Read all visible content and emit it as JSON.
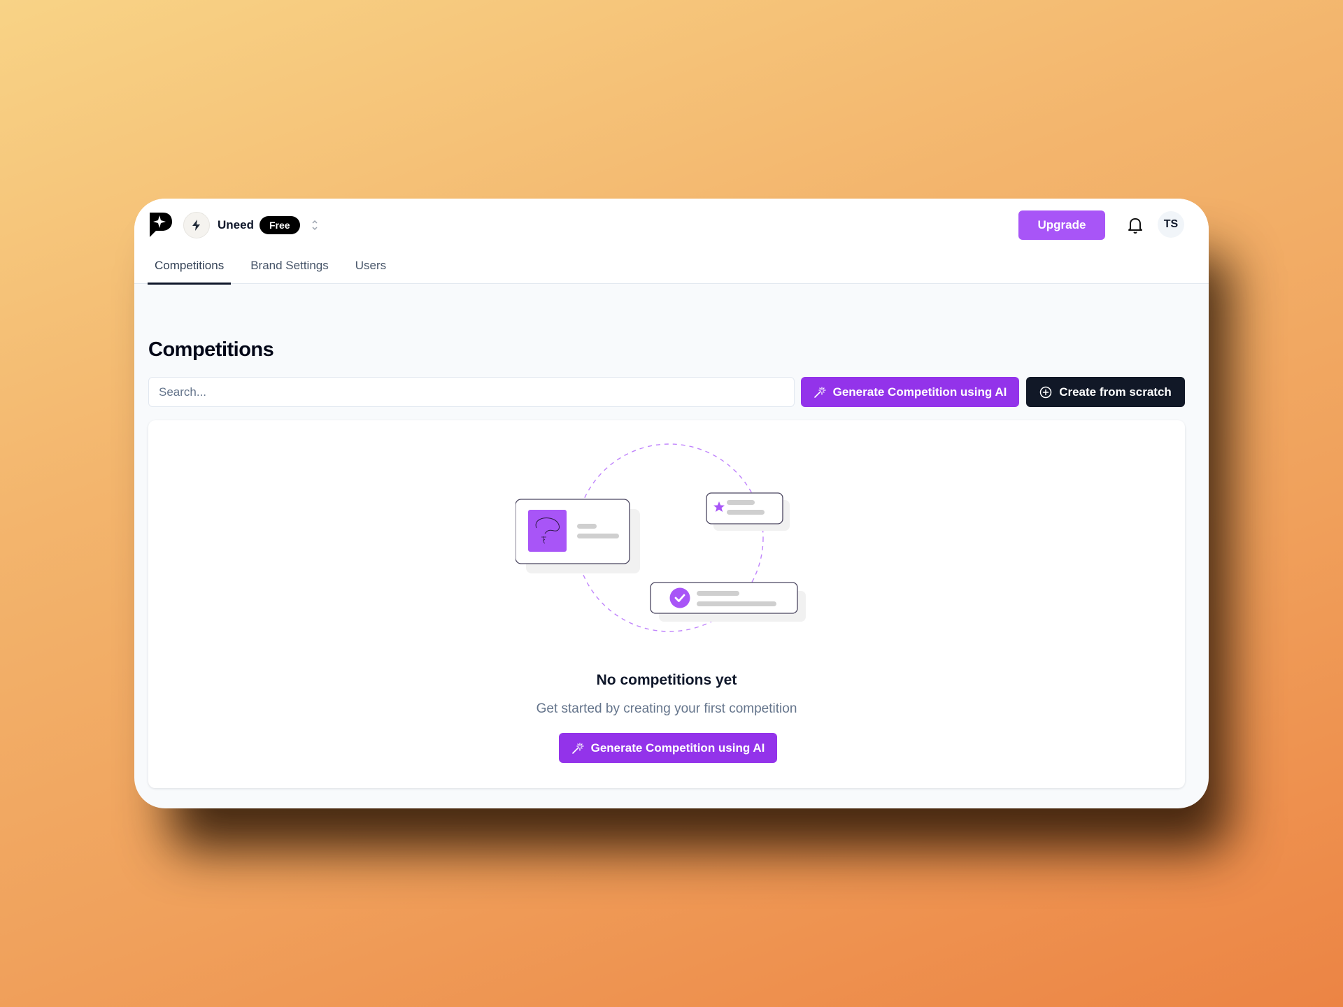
{
  "header": {
    "workspace_name": "Uneed",
    "plan_badge": "Free",
    "upgrade_label": "Upgrade",
    "avatar_initials": "TS",
    "icons": {
      "logo": "brand-logo-icon",
      "workspace": "lightning-icon",
      "switcher": "chevron-up-down-icon",
      "notifications": "bell-icon"
    }
  },
  "tabs": [
    {
      "label": "Competitions",
      "active": true
    },
    {
      "label": "Brand Settings",
      "active": false
    },
    {
      "label": "Users",
      "active": false
    }
  ],
  "main": {
    "title": "Competitions",
    "search": {
      "placeholder": "Search...",
      "value": ""
    },
    "generate_ai_label": "Generate Competition using AI",
    "create_scratch_label": "Create from scratch"
  },
  "empty_state": {
    "title": "No competitions yet",
    "subtitle": "Get started by creating your first competition",
    "cta_label": "Generate Competition using AI"
  },
  "colors": {
    "accent_purple": "#9333ea",
    "upgrade_purple": "#a855f7",
    "dark_button": "#111827",
    "illustration_purple": "#a855f7"
  }
}
